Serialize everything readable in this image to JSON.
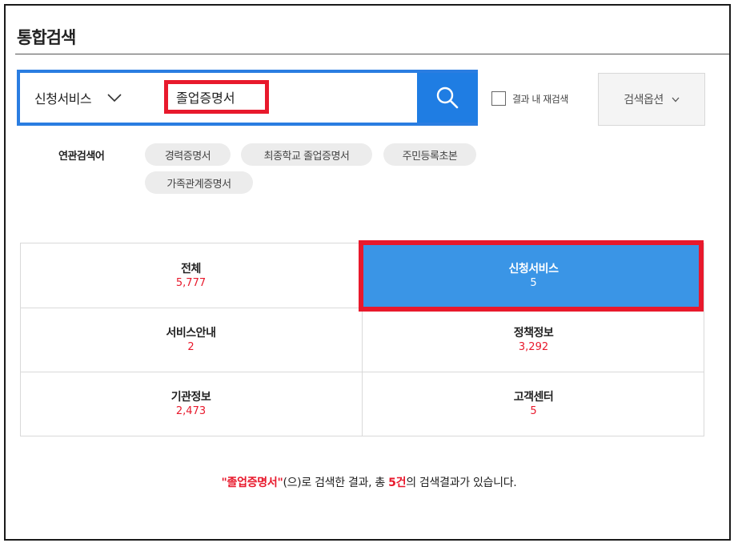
{
  "page": {
    "title": "통합검색"
  },
  "search": {
    "scope": "신청서비스",
    "query": "졸업증명서",
    "refine_label": "결과 내 재검색",
    "options_label": "검색옵션"
  },
  "related": {
    "label": "연관검색어",
    "tags": [
      "경력증명서",
      "최종학교 졸업증명서",
      "주민등록초본",
      "가족관계증명서"
    ]
  },
  "categories": [
    {
      "name": "전체",
      "count": "5,777"
    },
    {
      "name": "신청서비스",
      "count": "5"
    },
    {
      "name": "서비스안내",
      "count": "2"
    },
    {
      "name": "정책정보",
      "count": "3,292"
    },
    {
      "name": "기관정보",
      "count": "2,473"
    },
    {
      "name": "고객센터",
      "count": "5"
    }
  ],
  "summary": {
    "query_quoted": "\"졸업증명서\"",
    "text_1": "(으)로 검색한 결과, 총 ",
    "count": "5건",
    "text_2": "의 검색결과가 있습니다."
  },
  "colors": {
    "accent_blue": "#1f7de3",
    "active_tab": "#3a95e6",
    "highlight_red": "#e8192c"
  }
}
